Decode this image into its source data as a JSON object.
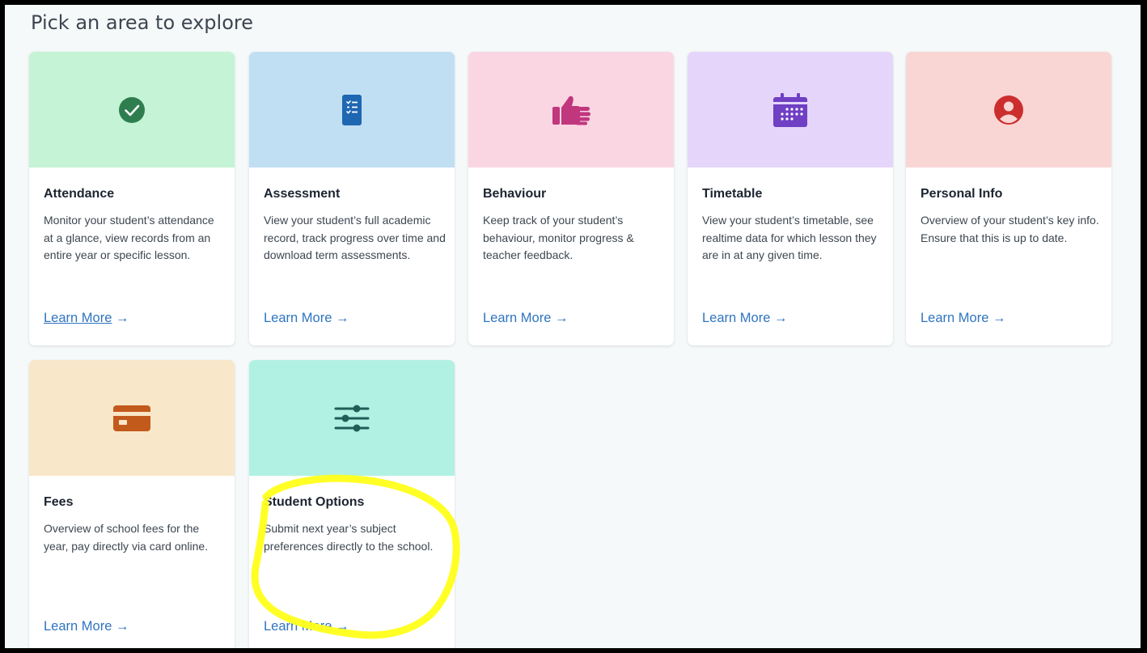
{
  "page": {
    "heading": "Pick an area to explore"
  },
  "cards": [
    {
      "title": "Attendance",
      "description": "Monitor your student’s attendance at a glance, view records from an entire year or specific lesson.",
      "link": "Learn More",
      "arrow": "→",
      "icon": "check-circle-icon",
      "banner_color": "#c5f3d5",
      "icon_color": "#2e7d4f"
    },
    {
      "title": "Assessment",
      "description": "View your student’s full academic record, track progress over time and download term assessments.",
      "link": "Learn More",
      "arrow": "→",
      "icon": "checklist-document-icon",
      "banner_color": "#c1dff3",
      "icon_color": "#1f66b3"
    },
    {
      "title": "Behaviour",
      "description": "Keep track of your student’s behaviour, monitor progress & teacher feedback.",
      "link": "Learn More",
      "arrow": "→",
      "icon": "thumbs-up-icon",
      "banner_color": "#fad6e3",
      "icon_color": "#c0377e"
    },
    {
      "title": "Timetable",
      "description": "View your student’s timetable, see realtime data for which lesson they are in at any given time.",
      "link": "Learn More",
      "arrow": "→",
      "icon": "calendar-icon",
      "banner_color": "#e5d5fa",
      "icon_color": "#6f3fc4"
    },
    {
      "title": "Personal Info",
      "description": "Overview of your student’s key info. Ensure that this is up to date.",
      "link": "Learn More",
      "arrow": "→",
      "icon": "user-circle-icon",
      "banner_color": "#f9d6d4",
      "icon_color": "#cc2e2e"
    },
    {
      "title": "Fees",
      "description": "Overview of school fees for the year, pay directly via card online.",
      "link": "Learn More",
      "arrow": "→",
      "icon": "credit-card-icon",
      "banner_color": "#f8e7c8",
      "icon_color": "#c25a1c"
    },
    {
      "title": "Student Options",
      "description": "Submit next year’s subject preferences directly to the school.",
      "link": "Learn More",
      "arrow": "→",
      "icon": "sliders-icon",
      "banner_color": "#b1f1e3",
      "icon_color": "#1d5f57"
    }
  ],
  "annotation": {
    "color": "#ffff1a"
  }
}
